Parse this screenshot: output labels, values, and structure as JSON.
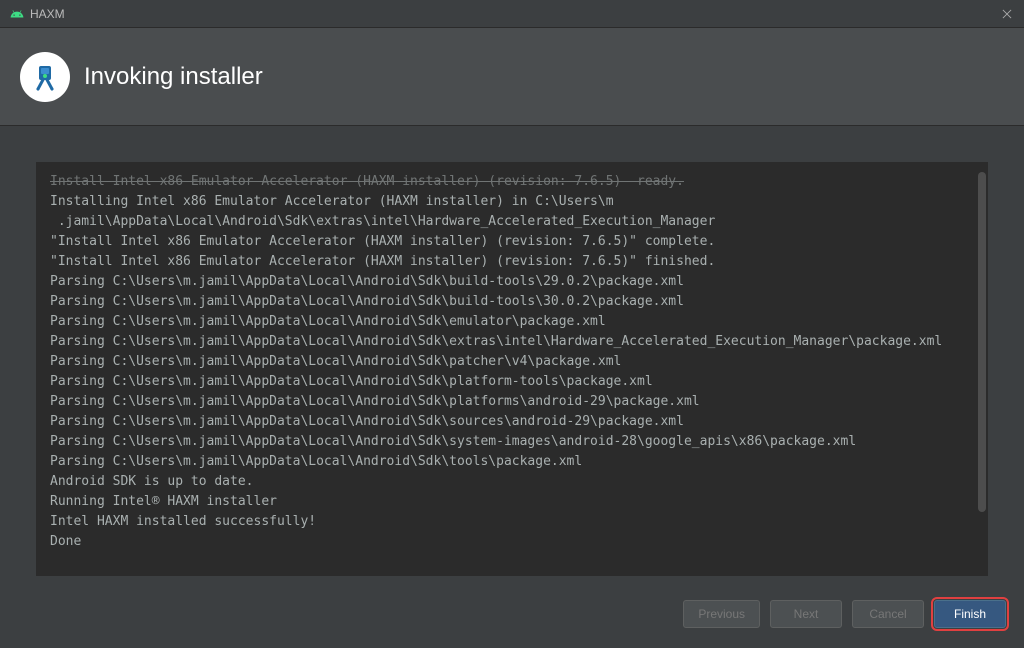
{
  "window": {
    "title": "HAXM"
  },
  "header": {
    "title": "Invoking installer"
  },
  "console": {
    "cutoff_line": "Install Intel x86 Emulator Accelerator (HAXM installer) (revision: 7.6.5)  ready.",
    "lines": [
      "Installing Intel x86 Emulator Accelerator (HAXM installer) in C:\\Users\\m",
      " .jamil\\AppData\\Local\\Android\\Sdk\\extras\\intel\\Hardware_Accelerated_Execution_Manager",
      "\"Install Intel x86 Emulator Accelerator (HAXM installer) (revision: 7.6.5)\" complete.",
      "\"Install Intel x86 Emulator Accelerator (HAXM installer) (revision: 7.6.5)\" finished.",
      "Parsing C:\\Users\\m.jamil\\AppData\\Local\\Android\\Sdk\\build-tools\\29.0.2\\package.xml",
      "Parsing C:\\Users\\m.jamil\\AppData\\Local\\Android\\Sdk\\build-tools\\30.0.2\\package.xml",
      "Parsing C:\\Users\\m.jamil\\AppData\\Local\\Android\\Sdk\\emulator\\package.xml",
      "Parsing C:\\Users\\m.jamil\\AppData\\Local\\Android\\Sdk\\extras\\intel\\Hardware_Accelerated_Execution_Manager\\package.xml",
      "Parsing C:\\Users\\m.jamil\\AppData\\Local\\Android\\Sdk\\patcher\\v4\\package.xml",
      "Parsing C:\\Users\\m.jamil\\AppData\\Local\\Android\\Sdk\\platform-tools\\package.xml",
      "Parsing C:\\Users\\m.jamil\\AppData\\Local\\Android\\Sdk\\platforms\\android-29\\package.xml",
      "Parsing C:\\Users\\m.jamil\\AppData\\Local\\Android\\Sdk\\sources\\android-29\\package.xml",
      "Parsing C:\\Users\\m.jamil\\AppData\\Local\\Android\\Sdk\\system-images\\android-28\\google_apis\\x86\\package.xml",
      "Parsing C:\\Users\\m.jamil\\AppData\\Local\\Android\\Sdk\\tools\\package.xml",
      "Android SDK is up to date.",
      "Running Intel® HAXM installer",
      "Intel HAXM installed successfully!",
      "Done"
    ]
  },
  "buttons": {
    "previous": "Previous",
    "next": "Next",
    "cancel": "Cancel",
    "finish": "Finish"
  }
}
